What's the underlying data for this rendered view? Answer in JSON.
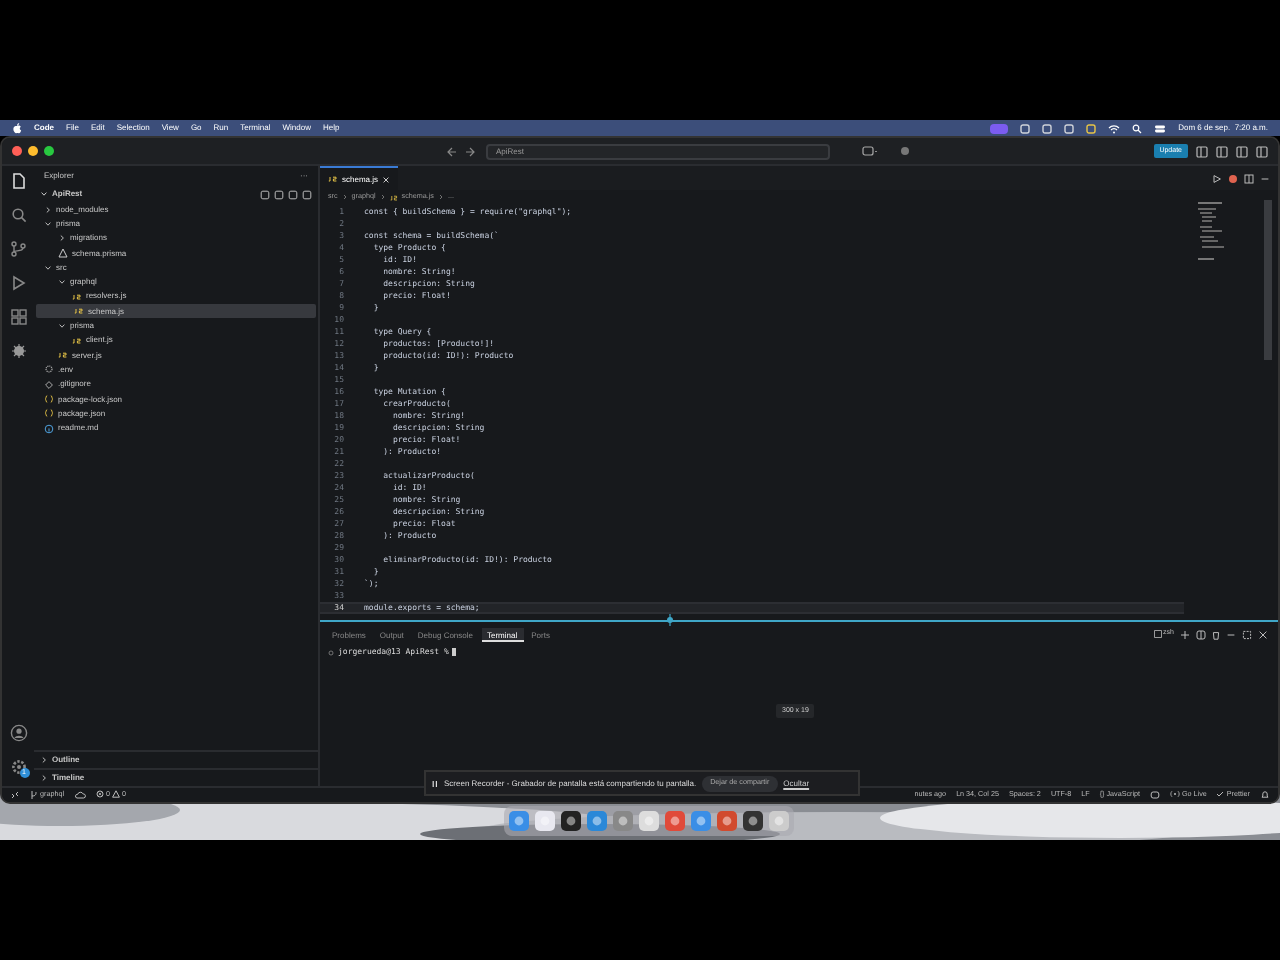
{
  "menubar": {
    "app": "Code",
    "menus": [
      "File",
      "Edit",
      "Selection",
      "View",
      "Go",
      "Run",
      "Terminal",
      "Window",
      "Help"
    ],
    "clock": "Dom 6 de sep.  7:20 a.m."
  },
  "window": {
    "search": "ApiRest",
    "update_button": "Update"
  },
  "activity_bar": {
    "settings_badge": "1"
  },
  "sidebar": {
    "title": "Explorer",
    "more": "···",
    "root": "ApiRest",
    "tree": [
      {
        "label": "node_modules",
        "kind": "folder",
        "expanded": false,
        "selected": false
      },
      {
        "label": "prisma",
        "kind": "folder",
        "expanded": true,
        "selected": false,
        "children": [
          {
            "label": "migrations",
            "kind": "folder",
            "expanded": false,
            "selected": false
          },
          {
            "label": "schema.prisma",
            "kind": "prisma",
            "selected": false
          }
        ]
      },
      {
        "label": "src",
        "kind": "folder",
        "expanded": true,
        "selected": false,
        "children": [
          {
            "label": "graphql",
            "kind": "folder",
            "expanded": true,
            "selected": false,
            "children": [
              {
                "label": "resolvers.js",
                "kind": "js",
                "selected": false
              },
              {
                "label": "schema.js",
                "kind": "js",
                "selected": true
              }
            ]
          },
          {
            "label": "prisma",
            "kind": "folder",
            "expanded": true,
            "selected": false,
            "children": [
              {
                "label": "client.js",
                "kind": "js",
                "selected": false
              }
            ]
          },
          {
            "label": "server.js",
            "kind": "js",
            "selected": false
          }
        ]
      },
      {
        "label": ".env",
        "kind": "env",
        "selected": false
      },
      {
        "label": ".gitignore",
        "kind": "git",
        "selected": false
      },
      {
        "label": "package-lock.json",
        "kind": "json",
        "selected": false
      },
      {
        "label": "package.json",
        "kind": "json",
        "selected": false
      },
      {
        "label": "readme.md",
        "kind": "md",
        "selected": false
      }
    ],
    "sections": [
      {
        "label": "Outline",
        "expanded": false
      },
      {
        "label": "Timeline",
        "expanded": false
      }
    ]
  },
  "editor": {
    "tabs": [
      {
        "label": "schema.js",
        "selected": true
      }
    ],
    "breadcrumb": [
      "src",
      "graphql",
      "schema.js",
      "..."
    ],
    "lines": [
      {
        "number": "1",
        "code": "const { buildSchema } = require(\"graphql\");",
        "current": false
      },
      {
        "number": "2",
        "current": false
      },
      {
        "number": "3",
        "code": "const schema = buildSchema(`",
        "current": false
      },
      {
        "number": "4",
        "code": "  type Producto {",
        "current": false
      },
      {
        "number": "5",
        "code": "    id: ID!",
        "current": false
      },
      {
        "number": "6",
        "code": "    nombre: String!",
        "current": false
      },
      {
        "number": "7",
        "code": "    descripcion: String",
        "current": false
      },
      {
        "number": "8",
        "code": "    precio: Float!",
        "current": false
      },
      {
        "number": "9",
        "code": "  }",
        "current": false
      },
      {
        "number": "10",
        "current": false
      },
      {
        "number": "11",
        "code": "  type Query {",
        "current": false
      },
      {
        "number": "12",
        "code": "    productos: [Producto!]!",
        "current": false
      },
      {
        "number": "13",
        "code": "    producto(id: ID!): Producto",
        "current": false
      },
      {
        "number": "14",
        "code": "  }",
        "current": false
      },
      {
        "number": "15",
        "current": false
      },
      {
        "number": "16",
        "code": "  type Mutation {",
        "current": false
      },
      {
        "number": "17",
        "code": "    crearProducto(",
        "current": false
      },
      {
        "number": "18",
        "code": "      nombre: String!",
        "current": false
      },
      {
        "number": "19",
        "code": "      descripcion: String",
        "current": false
      },
      {
        "number": "20",
        "code": "      precio: Float!",
        "current": false
      },
      {
        "number": "21",
        "code": "    ): Producto!",
        "current": false
      },
      {
        "number": "22",
        "current": false
      },
      {
        "number": "23",
        "code": "    actualizarProducto(",
        "current": false
      },
      {
        "number": "24",
        "code": "      id: ID!",
        "current": false
      },
      {
        "number": "25",
        "code": "      nombre: String",
        "current": false
      },
      {
        "number": "26",
        "code": "      descripcion: String",
        "current": false
      },
      {
        "number": "27",
        "code": "      precio: Float",
        "current": false
      },
      {
        "number": "28",
        "code": "    ): Producto",
        "current": false
      },
      {
        "number": "29",
        "current": false
      },
      {
        "number": "30",
        "code": "    eliminarProducto(id: ID!): Producto",
        "current": false
      },
      {
        "number": "31",
        "code": "  }",
        "current": false
      },
      {
        "number": "32",
        "code": "`);",
        "current": false
      },
      {
        "number": "33",
        "current": false
      },
      {
        "number": "34",
        "code": "module.exports = schema;",
        "current": true
      }
    ]
  },
  "panel": {
    "tabs": [
      {
        "label": "Problems",
        "selected": false
      },
      {
        "label": "Output",
        "selected": false
      },
      {
        "label": "Debug Console",
        "selected": false
      },
      {
        "label": "Terminal",
        "selected": true
      },
      {
        "label": "Ports",
        "selected": false
      }
    ],
    "shell": "zsh",
    "prompt": "jorgerueda@13 ApiRest %",
    "tooltip": "300 x 19"
  },
  "status_bar": {
    "left": [
      {
        "kind": "remote"
      },
      {
        "kind": "branch",
        "text": "graphql"
      },
      {
        "kind": "publish"
      },
      {
        "kind": "problems",
        "errors": "0",
        "warnings": "0"
      }
    ],
    "right": [
      {
        "kind": "text",
        "text": "nutes ago"
      },
      {
        "kind": "text",
        "text": "Ln 34, Col 25"
      },
      {
        "kind": "text",
        "text": "Spaces: 2"
      },
      {
        "kind": "text",
        "text": "UTF-8"
      },
      {
        "kind": "text",
        "text": "LF"
      },
      {
        "kind": "language",
        "text": "{} JavaScript"
      },
      {
        "kind": "copilot"
      },
      {
        "kind": "golive",
        "text": "Go Live"
      },
      {
        "kind": "prettier",
        "text": "Prettier"
      },
      {
        "kind": "bell"
      }
    ]
  },
  "notification": {
    "message": "Screen Recorder - Grabador de pantalla está compartiendo tu pantalla.",
    "stop_button": "Dejar de compartir",
    "hide_link": "Ocultar"
  }
}
